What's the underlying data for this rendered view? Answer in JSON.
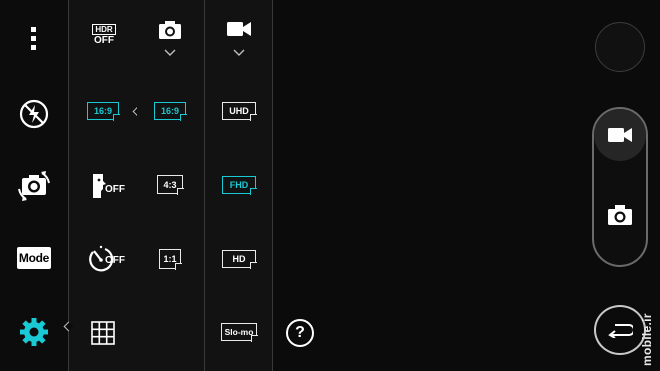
{
  "app": "Camera",
  "rail": {
    "items": [
      {
        "name": "more-menu",
        "icon": "more-vertical-icon"
      },
      {
        "name": "flash",
        "icon": "flash-off-icon"
      },
      {
        "name": "switch-camera",
        "icon": "switch-camera-icon"
      },
      {
        "name": "mode",
        "label": "Mode"
      },
      {
        "name": "settings",
        "icon": "gear-icon",
        "active": true
      }
    ]
  },
  "settings": {
    "hdr": {
      "label_top": "HDR",
      "label_bottom": "OFF"
    },
    "col1_ratio": {
      "label": "16:9",
      "selected": true
    },
    "voice_shutter": {
      "label": "OFF"
    },
    "timer": {
      "label": "OFF"
    },
    "grid": {
      "icon": "grid-icon"
    },
    "photo_size": [
      {
        "label": "16:9",
        "selected": true
      },
      {
        "label": "4:3",
        "selected": false
      },
      {
        "label": "1:1",
        "selected": false
      }
    ],
    "video_size": [
      {
        "label": "UHD",
        "selected": false
      },
      {
        "label": "FHD",
        "selected": true
      },
      {
        "label": "HD",
        "selected": false
      },
      {
        "label": "Slo-mo",
        "selected": false
      }
    ],
    "help": {
      "label": "?"
    }
  },
  "watermark": "mobile.ir",
  "colors": {
    "accent": "#19c9d4",
    "background": "#0b0b0b"
  }
}
